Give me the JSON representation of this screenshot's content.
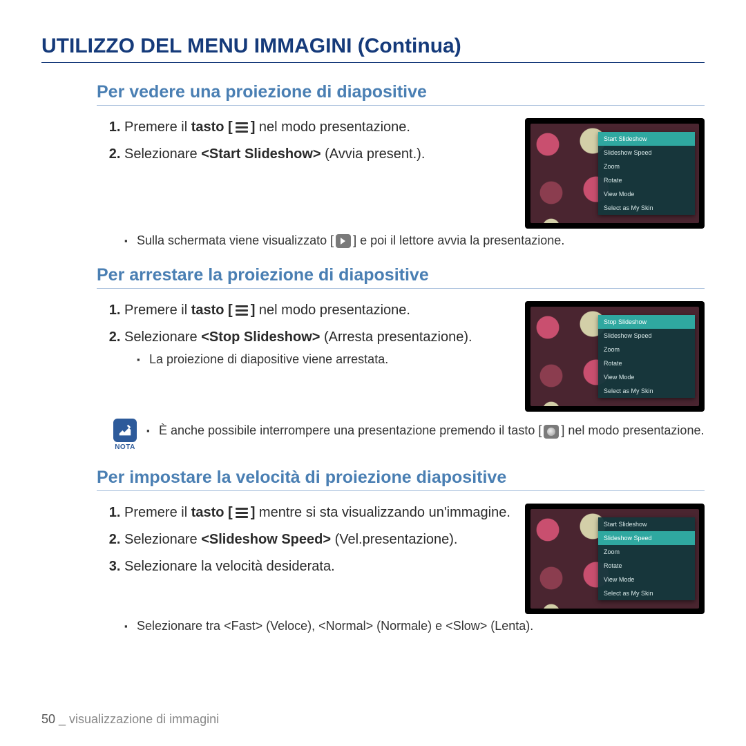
{
  "page": {
    "title": "UTILIZZO DEL MENU IMMAGINI (Continua)",
    "number": "50",
    "footer_sep": " _ ",
    "footer_section": "visualizzazione di immagini"
  },
  "menu_options": {
    "start": "Start Slideshow",
    "stop": "Stop Slideshow",
    "speed": "Slideshow Speed",
    "zoom": "Zoom",
    "rotate": "Rotate",
    "view": "View Mode",
    "skin": "Select as My Skin"
  },
  "sec1": {
    "heading": "Per vedere una proiezione di diapositive",
    "step1_a": "Premere il ",
    "step1_b": "tasto [",
    "step1_c": "] ",
    "step1_d": "nel modo presentazione.",
    "step2_a": "Selezionare ",
    "step2_b": "<Start Slideshow>",
    "step2_c": " (Avvia present.).",
    "sub1_a": "Sulla schermata viene visualizzato [",
    "sub1_b": "] e poi il lettore avvia la presentazione."
  },
  "sec2": {
    "heading": "Per arrestare la proiezione di diapositive",
    "step1_a": "Premere il ",
    "step1_b": "tasto [",
    "step1_c": "] ",
    "step1_d": "nel modo presentazione.",
    "step2_a": "Selezionare ",
    "step2_b": "<Stop Slideshow> ",
    "step2_c": "(Arresta presentazione).",
    "sub1": "La proiezione di diapositive viene arrestata.",
    "note_label": "NOTA",
    "note_a": "È anche possibile interrompere una presentazione premendo il tasto [",
    "note_b": "] nel modo presentazione."
  },
  "sec3": {
    "heading": "Per impostare la velocità di proiezione diapositive",
    "step1_a": "Premere il ",
    "step1_b": "tasto [",
    "step1_c": "] ",
    "step1_d": "mentre si sta visualizzando un'immagine.",
    "step2_a": "Selezionare ",
    "step2_b": "<Slideshow Speed>",
    "step2_c": " (Vel.presentazione).",
    "step3": "Selezionare la velocità desiderata.",
    "sub1": "Selezionare tra <Fast> (Veloce), <Normal> (Normale) e <Slow> (Lenta)."
  }
}
